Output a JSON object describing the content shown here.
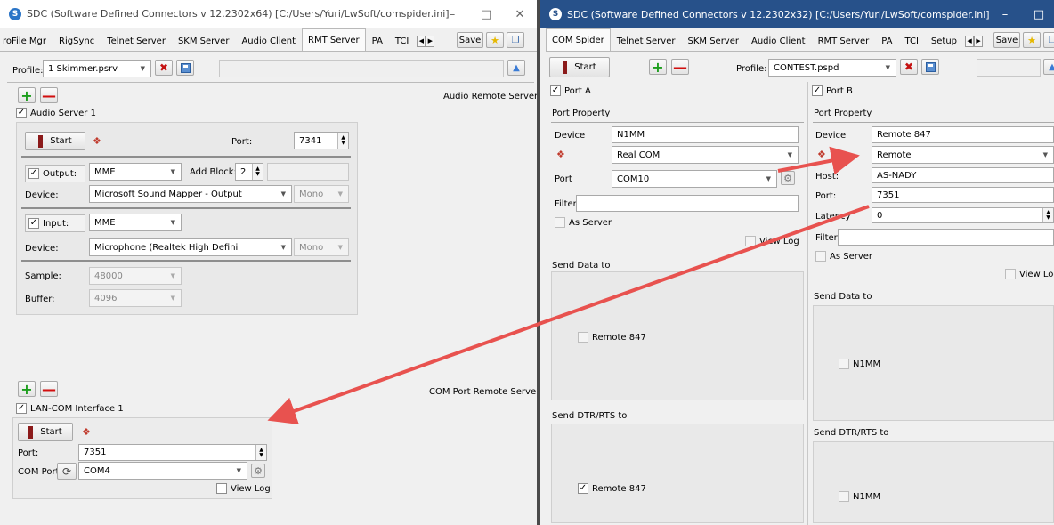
{
  "left": {
    "title": "SDC (Software Defined Connectors v 12.2302x64) [C:/Users/Yuri/LwSoft/comspider.ini]",
    "tabs": [
      "roFile Mgr",
      "RigSync",
      "Telnet Server",
      "SKM Server",
      "Audio Client",
      "RMT Server",
      "PA",
      "TCI"
    ],
    "active_tab": "RMT Server",
    "save_label": "Save",
    "profile_label": "Profile:",
    "profile_value": "1 Skimmer.psrv",
    "audio_section_title": "Audio Remote Servers",
    "audio_server_label": "Audio Server 1",
    "start_label": "Start",
    "port_label": "Port:",
    "port_value": "7341",
    "output_label": "Output:",
    "output_value": "MME",
    "add_block_label": "Add Block:",
    "add_block_value": "2",
    "device_label": "Device:",
    "output_device_value": "Microsoft Sound Mapper - Output",
    "mono_label": "Mono",
    "input_label": "Input:",
    "input_value": "MME",
    "input_device_value": "Microphone (Realtek High Defini",
    "sample_label": "Sample:",
    "sample_value": "48000",
    "buffer_label": "Buffer:",
    "buffer_value": "4096",
    "com_section_title": "COM Port Remote Servers",
    "lan_com_label": "LAN-COM Interface 1",
    "lan_port_label": "Port:",
    "lan_port_value": "7351",
    "com_port_label": "COM Port",
    "com_port_value": "COM4",
    "view_log_label": "View Log"
  },
  "right": {
    "title": "SDC (Software Defined Connectors v 12.2302x32) [C:/Users/Yuri/LwSoft/comspider.ini]",
    "tabs": [
      "COM Spider",
      "Telnet Server",
      "SKM Server",
      "Audio Client",
      "RMT Server",
      "PA",
      "TCI",
      "Setup"
    ],
    "active_tab": "COM Spider",
    "save_label": "Save",
    "start_label": "Start",
    "profile_label": "Profile:",
    "profile_value": "CONTEST.pspd",
    "port_a": {
      "label": "Port A",
      "property_label": "Port Property",
      "device_label": "Device",
      "device_value": "N1MM",
      "type_value": "Real COM",
      "port_label": "Port",
      "port_value": "COM10",
      "filter_label": "Filter",
      "as_server_label": "As Server",
      "view_log_label": "View Log",
      "send_data_label": "Send Data to",
      "send_data_item": "Remote 847",
      "send_dtr_label": "Send DTR/RTS to",
      "send_dtr_item": "Remote 847"
    },
    "port_b": {
      "label": "Port B",
      "property_label": "Port Property",
      "device_label": "Device",
      "device_value": "Remote 847",
      "type_value": "Remote",
      "host_label": "Host:",
      "host_value": "AS-NADY",
      "port_label": "Port:",
      "port_value": "7351",
      "latency_label": "Latency",
      "latency_value": "0",
      "filter_label": "Filter",
      "as_server_label": "As Server",
      "view_log_label": "View Log",
      "send_data_label": "Send Data to",
      "send_data_item": "N1MM",
      "send_dtr_label": "Send DTR/RTS to",
      "send_dtr_item": "N1MM"
    }
  },
  "colors": {
    "arrow": "#e8524f",
    "right_titlebar": "#27518a",
    "start_glyph": "#8b1a1a"
  }
}
